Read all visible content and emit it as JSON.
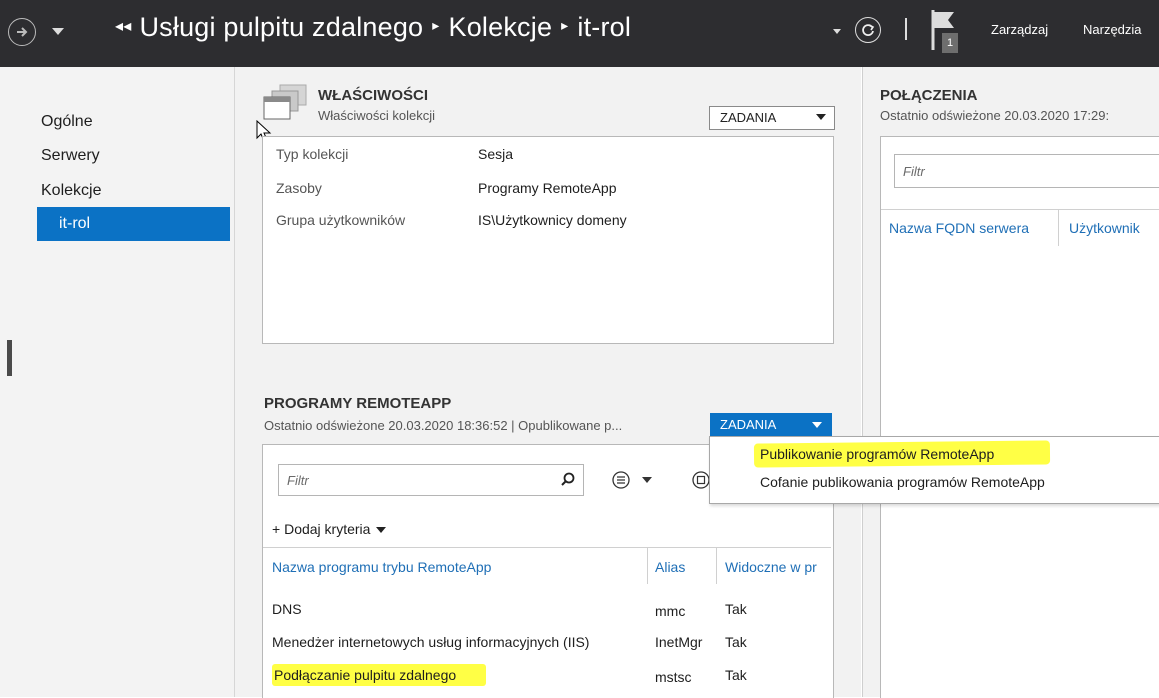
{
  "titlebar": {
    "crumbs": [
      "Usługi pulpitu zdalnego",
      "Kolekcje",
      "it-rol"
    ],
    "notification_count": "1",
    "menu": [
      "Zarządzaj",
      "Narzędzia"
    ]
  },
  "nav": {
    "items": [
      "Ogólne",
      "Serwery",
      "Kolekcje"
    ],
    "selected": "it-rol"
  },
  "properties": {
    "title": "WŁAŚCIWOŚCI",
    "subtitle": "Właściwości kolekcji",
    "tasks_label": "ZADANIA",
    "rows": [
      {
        "label": "Typ kolekcji",
        "value": "Sesja"
      },
      {
        "label": "Zasoby",
        "value": "Programy RemoteApp"
      },
      {
        "label": "Grupa użytkowników",
        "value": "IS\\Użytkownicy domeny"
      }
    ]
  },
  "remoteapp": {
    "title": "PROGRAMY REMOTEAPP",
    "subtitle": "Ostatnio odświeżone 20.03.2020 18:36:52 | Opublikowane p...",
    "tasks_label": "ZADANIA",
    "filter_placeholder": "Filtr",
    "add_criteria": "Dodaj kryteria",
    "columns": [
      "Nazwa programu trybu RemoteApp",
      "Alias",
      "Widoczne w pr"
    ],
    "rows": [
      {
        "name": "DNS",
        "alias": "mmc",
        "visible": "Tak"
      },
      {
        "name": "Menedżer internetowych usług informacyjnych (IIS)",
        "alias": "InetMgr",
        "visible": "Tak"
      },
      {
        "name": "Podłączanie pulpitu zdalnego",
        "alias": "mstsc",
        "visible": "Tak"
      }
    ]
  },
  "connections": {
    "title": "POŁĄCZENIA",
    "subtitle": "Ostatnio odświeżone 20.03.2020 17:29:",
    "filter_placeholder": "Filtr",
    "columns": [
      "Nazwa FQDN serwera",
      "Użytkownik"
    ]
  },
  "tasks_menu": {
    "items": [
      "Publikowanie programów RemoteApp",
      "Cofanie publikowania programów RemoteApp"
    ]
  },
  "colors": {
    "accent": "#0b72c5",
    "highlight": "#ffff45",
    "titlebar": "#2d2d30"
  }
}
